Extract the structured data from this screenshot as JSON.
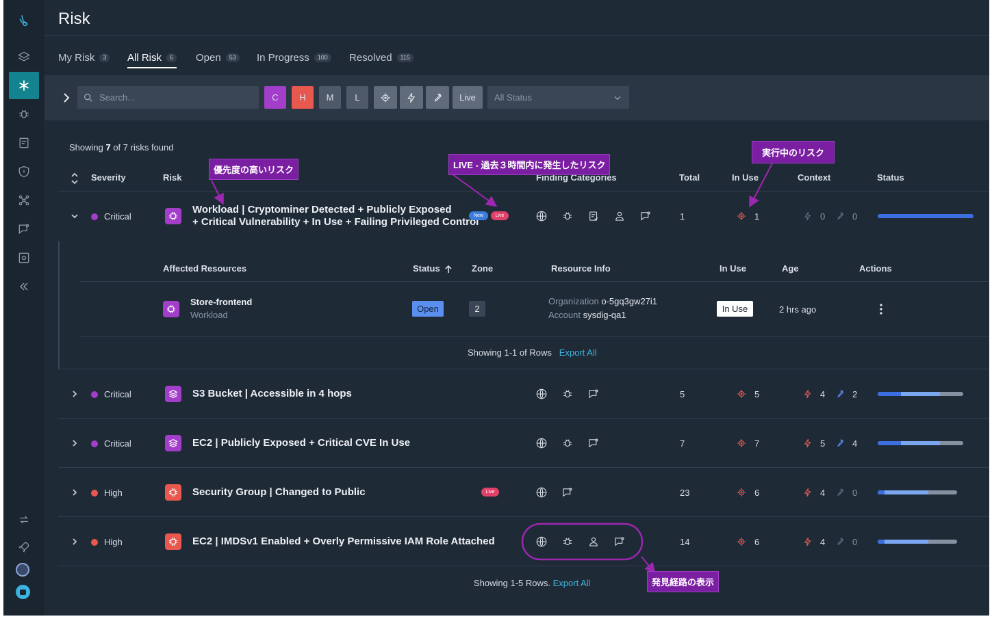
{
  "page": {
    "title": "Risk"
  },
  "tabs": [
    {
      "label": "My Risk",
      "count": "3"
    },
    {
      "label": "All Risk",
      "count": "6"
    },
    {
      "label": "Open",
      "count": "53"
    },
    {
      "label": "In Progress",
      "count": "100"
    },
    {
      "label": "Resolved",
      "count": "115"
    }
  ],
  "filters": {
    "search_placeholder": "Search...",
    "severity_buttons": [
      "C",
      "H",
      "M",
      "L"
    ],
    "live_label": "Live",
    "status_select": "All Status"
  },
  "summary": {
    "prefix": "Showing ",
    "shown": "7",
    "suffix": " of 7 risks found"
  },
  "columns": [
    "Severity",
    "Risk",
    "Finding Categories",
    "Total",
    "In Use",
    "Context",
    "Status"
  ],
  "risks": [
    {
      "severity": "Critical",
      "title_line1": "Workload | Cryptominer Detected + Publicly Exposed",
      "title_line2": "+ Critical Vulnerability + In Use + Failing Privileged Control",
      "badges": [
        "New",
        "Live"
      ],
      "total": "1",
      "in_use": "1",
      "context_exploit": "0",
      "context_fix": "0"
    },
    {
      "severity": "Critical",
      "title": "S3 Bucket | Accessible in 4 hops",
      "total": "5",
      "in_use": "5",
      "context_exploit": "4",
      "context_fix": "2"
    },
    {
      "severity": "Critical",
      "title": "EC2 | Publicly Exposed + Critical CVE In Use",
      "total": "7",
      "in_use": "7",
      "context_exploit": "5",
      "context_fix": "4"
    },
    {
      "severity": "High",
      "title": "Security Group | Changed to Public",
      "badges": [
        "Live"
      ],
      "total": "23",
      "in_use": "6",
      "context_exploit": "4",
      "context_fix": "0"
    },
    {
      "severity": "High",
      "title": "EC2 | IMDSv1 Enabled + Overly Permissive IAM Role Attached",
      "total": "14",
      "in_use": "6",
      "context_exploit": "4",
      "context_fix": "0"
    }
  ],
  "expanded": {
    "columns": [
      "Affected Resources",
      "Status",
      "Zone",
      "Resource Info",
      "In Use",
      "Age",
      "Actions"
    ],
    "resource": {
      "name": "Store-frontend",
      "type": "Workload",
      "status": "Open",
      "zone": "2",
      "org_label": "Organization",
      "org_value": "o-5gq3gw27i1",
      "account_label": "Account",
      "account_value": "sysdig-qa1",
      "in_use": "In Use",
      "age": "2 hrs ago"
    },
    "footer_text": "Showing 1-1 of Rows",
    "export_label": "Export All"
  },
  "footer": {
    "text": "Showing 1-5 Rows.",
    "export_label": "Export All"
  },
  "annotations": {
    "high_priority": "優先度の高いリスク",
    "live": "LIVE - 過去３時間内に発生したリスク",
    "in_use": "実行中のリスク",
    "discovery_path": "発見経路の表示"
  },
  "status_progress": [
    {
      "segments": [
        1.0,
        0.0
      ]
    },
    {
      "segments": [
        0.27,
        0.46
      ]
    },
    {
      "segments": [
        0.27,
        0.46
      ]
    },
    {
      "segments": [
        0.09,
        0.55
      ]
    },
    {
      "segments": [
        0.09,
        0.55
      ]
    }
  ],
  "colors": {
    "critical": "#a23ec9",
    "high": "#e8584f",
    "accent": "#12838f",
    "link": "#3fb6e0",
    "annotation": "#7b1fa2"
  }
}
